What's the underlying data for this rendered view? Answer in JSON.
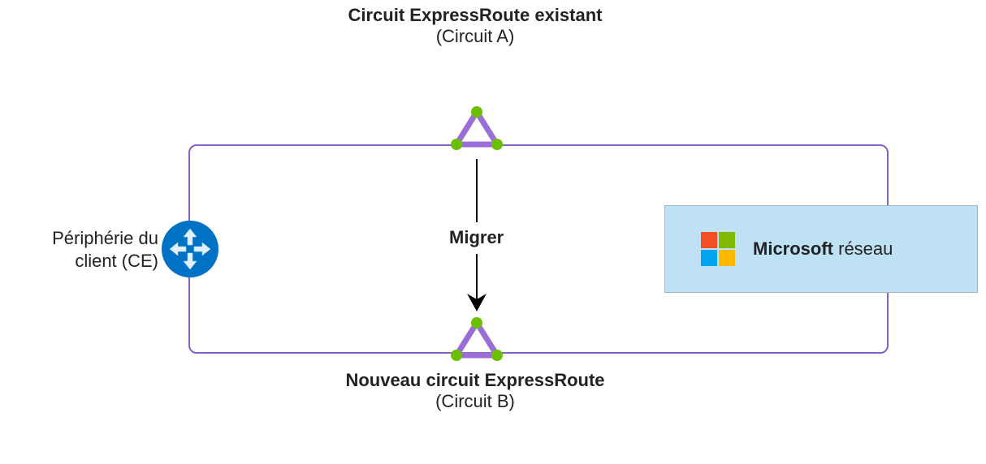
{
  "topLabel": {
    "title": "Circuit ExpressRoute existant",
    "subtitle": "(Circuit A)"
  },
  "bottomLabel": {
    "title": "Nouveau circuit ExpressRoute",
    "subtitle": "(Circuit B)"
  },
  "leftLabel": {
    "line1": "Périphérie du",
    "line2": "client (CE)"
  },
  "migrateLabel": "Migrer",
  "msBox": {
    "bold": "Microsoft",
    "normal": " réseau"
  },
  "colors": {
    "border": "#8661c5",
    "triangleStroke": "#9b6dd7",
    "dotFill": "#5bb300",
    "ceCircle": "#0072c6",
    "msBoxBg": "#bee2f4"
  },
  "icons": {
    "ce": "ce-arrows-icon",
    "triangle": "expressroute-triangle-icon",
    "msLogo": "microsoft-logo-icon"
  }
}
